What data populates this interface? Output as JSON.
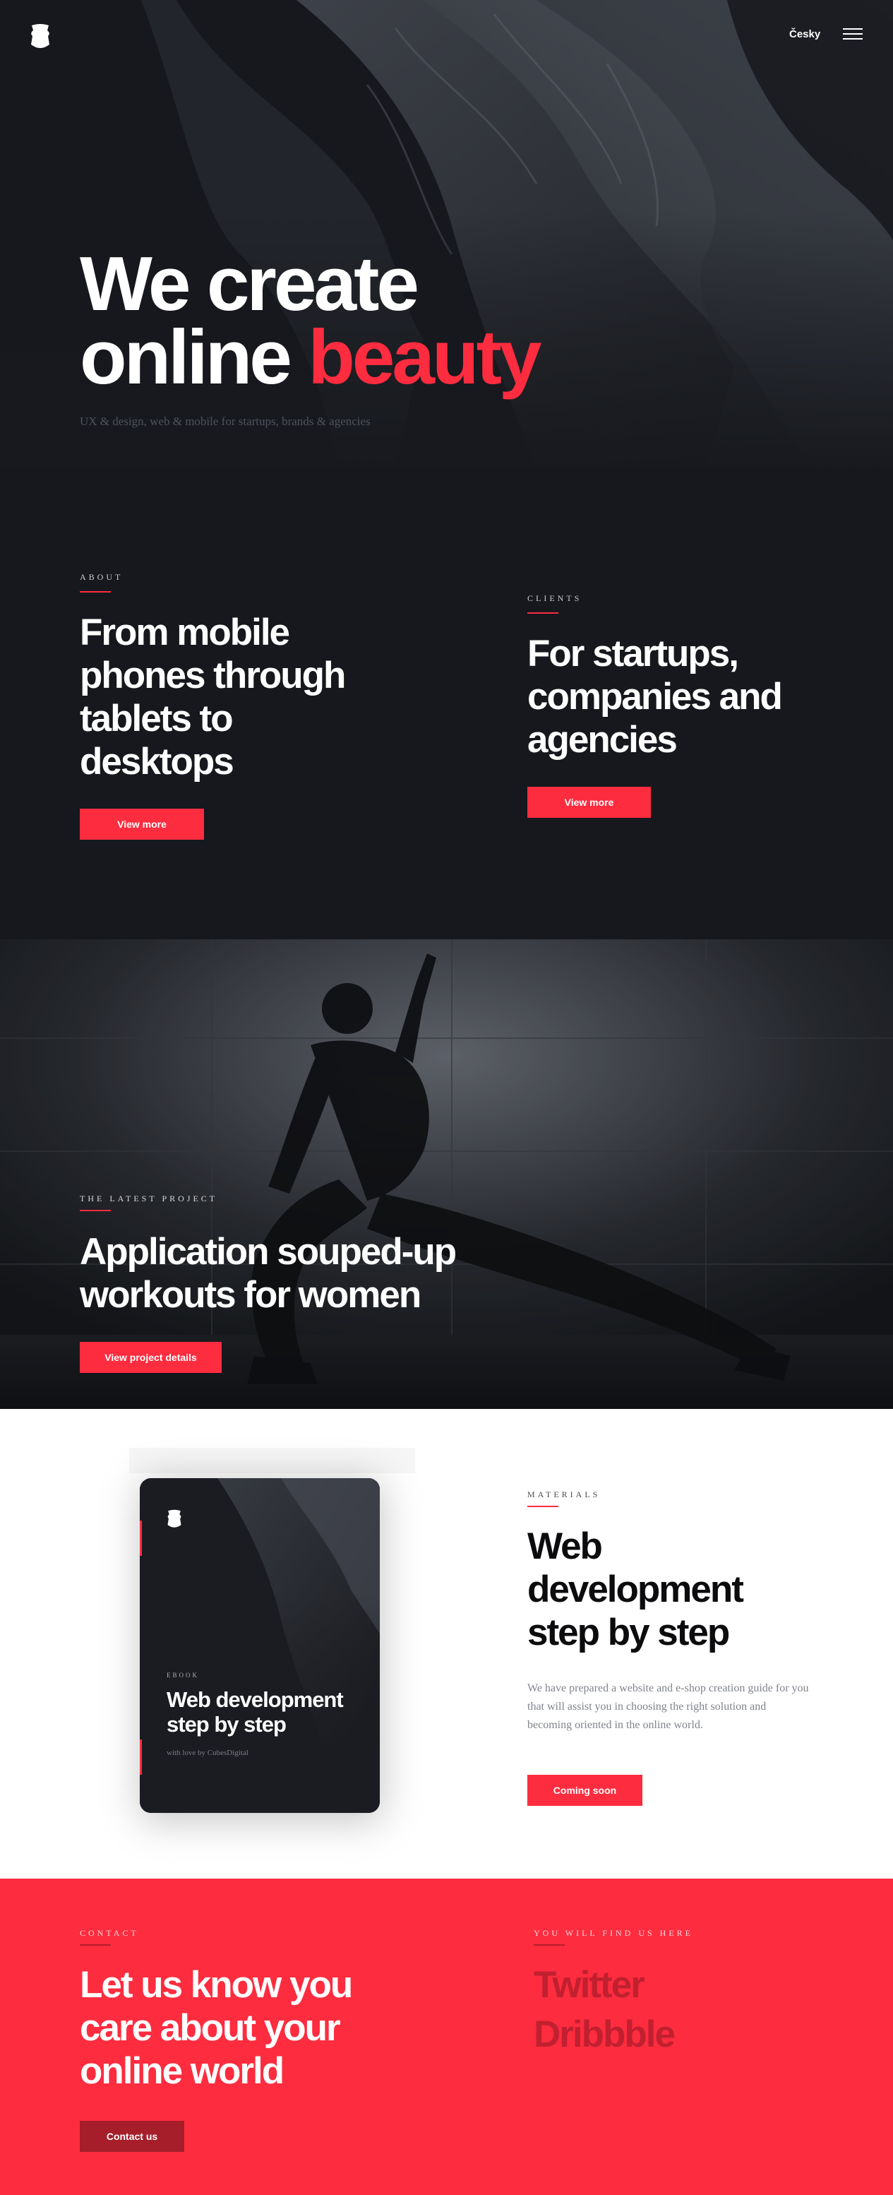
{
  "header": {
    "language_label": "Česky",
    "logo_icon": "shield-logo-icon",
    "menu_icon": "hamburger-menu-icon"
  },
  "hero": {
    "title_line1": "We create",
    "title_line2_plain": "online ",
    "title_line2_accent": "beauty",
    "subtitle": "UX & design, web & mobile for startups, brands & agencies"
  },
  "about": {
    "label": "About",
    "title": "From mobile phones through tablets to desktops",
    "button_label": "View more"
  },
  "clients": {
    "label": "Clients",
    "title": "For startups, companies and agencies",
    "button_label": "View more"
  },
  "project": {
    "label": "The latest project",
    "title": "Application souped-up workouts for women",
    "button_label": "View project details"
  },
  "materials": {
    "label": "Materials",
    "title": "Web development step by step",
    "body": "We have prepared a website and e-shop creation guide for you that will assist you in choosing the right solution and becoming oriented in the online world.",
    "button_label": "Coming soon",
    "book": {
      "label": "EBOOK",
      "title": "Web development step by step",
      "subtitle": "with love by CubesDigital"
    }
  },
  "contact": {
    "label": "Contact",
    "title": "Let us know you care about your online world",
    "button_label": "Contact us",
    "find_label": "You will find us here",
    "social": [
      "Twitter",
      "Dribbble"
    ]
  },
  "colors": {
    "accent": "#fe2c3f",
    "dark_bg": "#16181d",
    "contact_bg": "#fe2c3f",
    "contact_button": "#a51e2a",
    "social_link": "#c0202f"
  }
}
